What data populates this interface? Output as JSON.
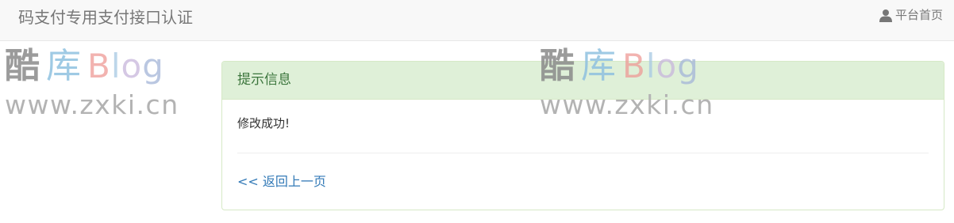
{
  "navbar": {
    "brand": "码支付专用支付接口认证",
    "home_label": "平台首页",
    "home_icon": "user-icon"
  },
  "watermark": {
    "logo_char1": "酷",
    "logo_char2": "库",
    "blog_b": "B",
    "blog_l": "l",
    "blog_o": "o",
    "blog_g": "g",
    "url": "www.zxki.cn"
  },
  "panel": {
    "heading": "提示信息",
    "message": "修改成功!",
    "back_link": "<< 返回上一页"
  },
  "colors": {
    "panel_heading_bg": "#dff0d8",
    "panel_heading_text": "#3c763d",
    "link": "#337ab7",
    "navbar_bg": "#f8f8f8"
  }
}
